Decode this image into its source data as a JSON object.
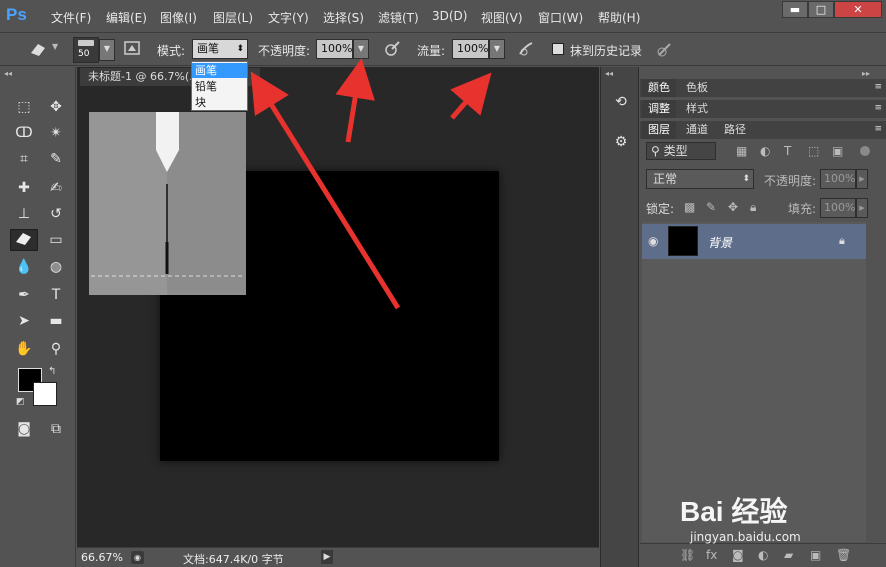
{
  "app": {
    "logo": "Ps"
  },
  "menu": [
    "文件(F)",
    "编辑(E)",
    "图像(I)",
    "图层(L)",
    "文字(Y)",
    "选择(S)",
    "滤镜(T)",
    "3D(D)",
    "视图(V)",
    "窗口(W)",
    "帮助(H)"
  ],
  "window_controls": {
    "minimize": "▬",
    "maximize": "□",
    "close": "✕"
  },
  "options": {
    "brush_size": "50",
    "mode_label": "模式:",
    "mode_value": "画笔",
    "opacity_label": "不透明度:",
    "opacity_value": "100%",
    "flow_label": "流量:",
    "flow_value": "100%",
    "erase_history_label": "抹到历史记录"
  },
  "mode_menu": {
    "options": [
      "画笔",
      "铅笔",
      "块"
    ],
    "selected": "画笔"
  },
  "document": {
    "tab_title": "未标题-1 @ 66.7%(...",
    "zoom": "66.67%",
    "doc_info": "文档:647.4K/0 字节"
  },
  "panels": {
    "color_tabs": [
      "颜色",
      "色板"
    ],
    "adjust_tabs": [
      "调整",
      "样式"
    ],
    "layer_tabs": [
      "图层",
      "通道",
      "路径"
    ],
    "filter_kind": "类型",
    "blend_mode": "正常",
    "opacity_label": "不透明度:",
    "opacity_value": "100%",
    "lock_label": "锁定:",
    "fill_label": "填充:",
    "fill_value": "100%",
    "layer_name": "背景"
  },
  "watermark": {
    "text": "Bai 经验",
    "url": "jingyan.baidu.com"
  },
  "colors": {
    "ui_bg": "#535353",
    "dark": "#282828",
    "selection": "#3399ff",
    "arrow": "#e8322e",
    "layer_sel": "#5e6e8a"
  },
  "icons": [
    "ps-logo",
    "eraser-icon",
    "brush-preset-icon",
    "toggle-brush-panel-icon",
    "airbrush-icon",
    "pressure-icon",
    "eye-icon",
    "lock-icon"
  ]
}
